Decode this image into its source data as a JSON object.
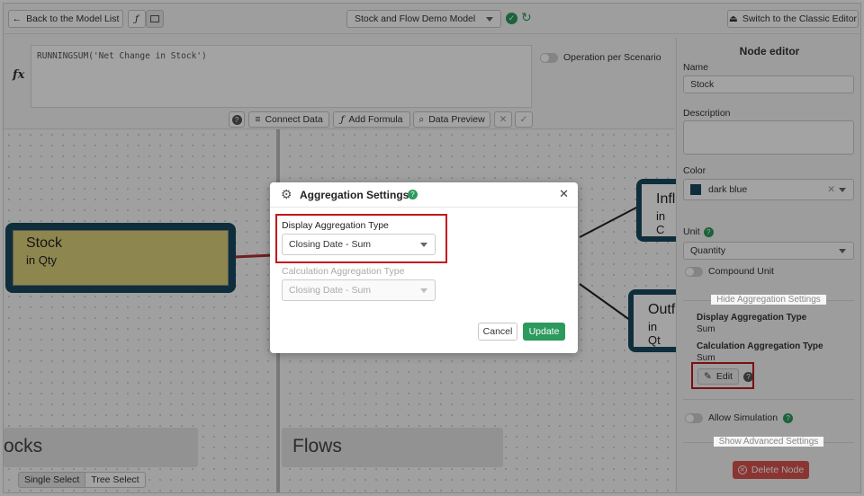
{
  "topbar": {
    "back_label": "Back to the Model List",
    "model_name": "Stock and Flow Demo Model",
    "classic_label": "Switch to the Classic Editor"
  },
  "formula": {
    "text": "RUNNINGSUM('Net Change in Stock')",
    "operation_label": "Operation per Scenario",
    "fx_symbol": "fx",
    "toolbar": {
      "help": "?",
      "connect_data": "Connect Data",
      "add_formula": "Add Formula",
      "data_preview": "Data Preview"
    }
  },
  "canvas": {
    "stock_node": {
      "title": "Stock",
      "subtitle": "in Qty"
    },
    "inflow_node": {
      "title": "Infl",
      "subtitle": "in C"
    },
    "outflow_node": {
      "title": "Outf",
      "subtitle": "in Qt"
    },
    "stocks_header": "ocks",
    "flows_header": "Flows",
    "single_select": "Single Select",
    "tree_select": "Tree Select"
  },
  "side_panel": {
    "title": "Node editor",
    "name_label": "Name",
    "name_value": "Stock",
    "description_label": "Description",
    "description_value": "",
    "color_label": "Color",
    "color_value": "dark blue",
    "color_hex": "#18495f",
    "unit_label": "Unit",
    "unit_value": "Quantity",
    "compound_unit_label": "Compound Unit",
    "hide_aggregation_label": "Hide Aggregation Settings",
    "display_agg_label": "Display Aggregation Type",
    "display_agg_value": "Sum",
    "calc_agg_label": "Calculation Aggregation Type",
    "calc_agg_value": "Sum",
    "edit_label": "Edit",
    "allow_simulation_label": "Allow Simulation",
    "show_advanced_label": "Show Advanced Settings",
    "delete_label": "Delete Node"
  },
  "dialog": {
    "title": "Aggregation Settings",
    "display_label": "Display Aggregation Type",
    "display_value": "Closing Date - Sum",
    "calc_label": "Calculation Aggregation Type",
    "calc_value": "Closing Date - Sum",
    "cancel_label": "Cancel",
    "update_label": "Update"
  },
  "colors": {
    "accent_green": "#2c9a5c",
    "highlight_red": "#c4161c",
    "node_dark": "#18495f",
    "node_fill": "#ddd27a"
  }
}
